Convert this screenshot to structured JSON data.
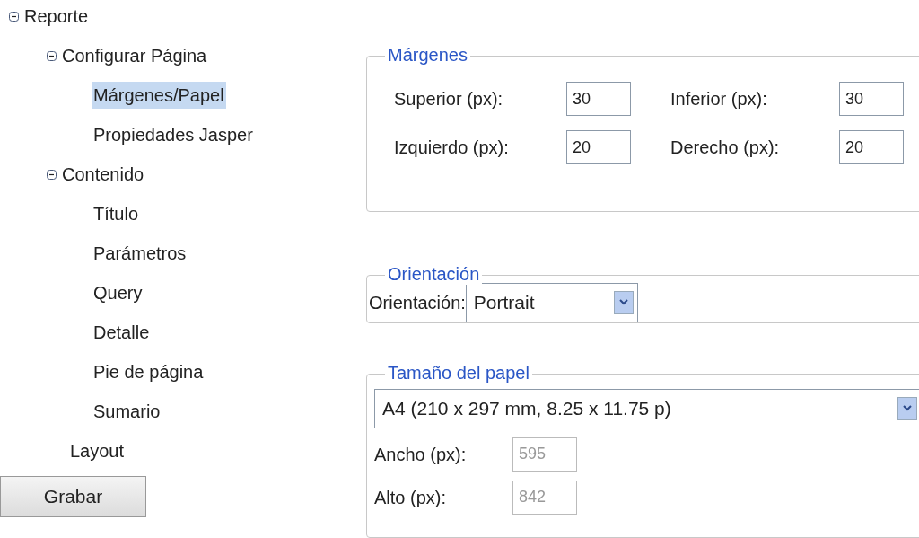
{
  "tree": [
    {
      "label": "Reporte",
      "expanded": true,
      "selected": false,
      "children": [
        {
          "label": "Configurar Página",
          "expanded": true,
          "selected": false,
          "children": [
            {
              "label": "Márgenes/Papel",
              "selected": true
            },
            {
              "label": "Propiedades Jasper",
              "selected": false
            }
          ]
        },
        {
          "label": "Contenido",
          "expanded": true,
          "selected": false,
          "children": [
            {
              "label": "Título",
              "selected": false
            },
            {
              "label": "Parámetros",
              "selected": false
            },
            {
              "label": "Query",
              "selected": false
            },
            {
              "label": "Detalle",
              "selected": false
            },
            {
              "label": "Pie de página",
              "selected": false
            },
            {
              "label": "Sumario",
              "selected": false
            }
          ]
        },
        {
          "label": "Layout",
          "selected": false
        }
      ]
    }
  ],
  "save_button": "Grabar",
  "margins": {
    "legend": "Márgenes",
    "fields": [
      {
        "label": "Superior (px):",
        "value": "30"
      },
      {
        "label": "Inferior (px):",
        "value": "30"
      },
      {
        "label": "Izquierdo (px):",
        "value": "20"
      },
      {
        "label": "Derecho (px):",
        "value": "20"
      }
    ]
  },
  "orientation": {
    "legend": "Orientación",
    "label": "Orientación:",
    "value": "Portrait"
  },
  "paper_size": {
    "legend": "Tamaño del papel",
    "value": "A4 (210 x 297 mm, 8.25 x 11.75 p)",
    "fields": [
      {
        "label": "Ancho (px):",
        "value": "595",
        "disabled": true
      },
      {
        "label": "Alto (px):",
        "value": "842",
        "disabled": true
      }
    ]
  }
}
